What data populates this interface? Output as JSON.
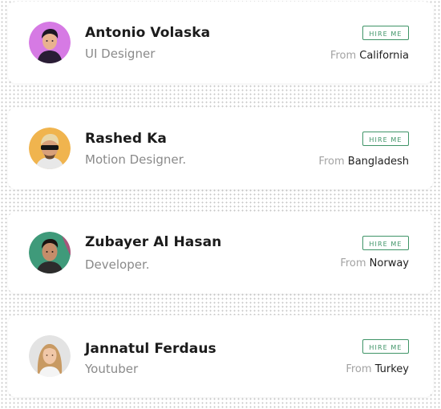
{
  "people": [
    {
      "name": "Antonio Volaska",
      "role": "UI Designer",
      "hire_label": "HIRE ME",
      "from_label": "From",
      "location": "California",
      "avatar_icon": "avatar-portrait-icon",
      "avatar_bg": "#d67ae4"
    },
    {
      "name": "Rashed Ka",
      "role": "Motion Designer.",
      "hire_label": "HIRE ME",
      "from_label": "From",
      "location": "Bangladesh",
      "avatar_icon": "avatar-portrait-icon",
      "avatar_bg": "#f0b44e"
    },
    {
      "name": "Zubayer Al Hasan",
      "role": "Developer.",
      "hire_label": "HIRE ME",
      "from_label": "From",
      "location": "Norway",
      "avatar_icon": "avatar-portrait-icon",
      "avatar_bg": "#3f9a7a"
    },
    {
      "name": "Jannatul Ferdaus",
      "role": "Youtuber",
      "hire_label": "HIRE ME",
      "from_label": "From",
      "location": "Turkey",
      "avatar_icon": "avatar-portrait-icon",
      "avatar_bg": "#e3e3e3"
    }
  ],
  "colors": {
    "accent": "#3f9467",
    "name_text": "#1b1b1b",
    "role_text": "#8a8a8a",
    "from_label_text": "#a3a3a3"
  }
}
